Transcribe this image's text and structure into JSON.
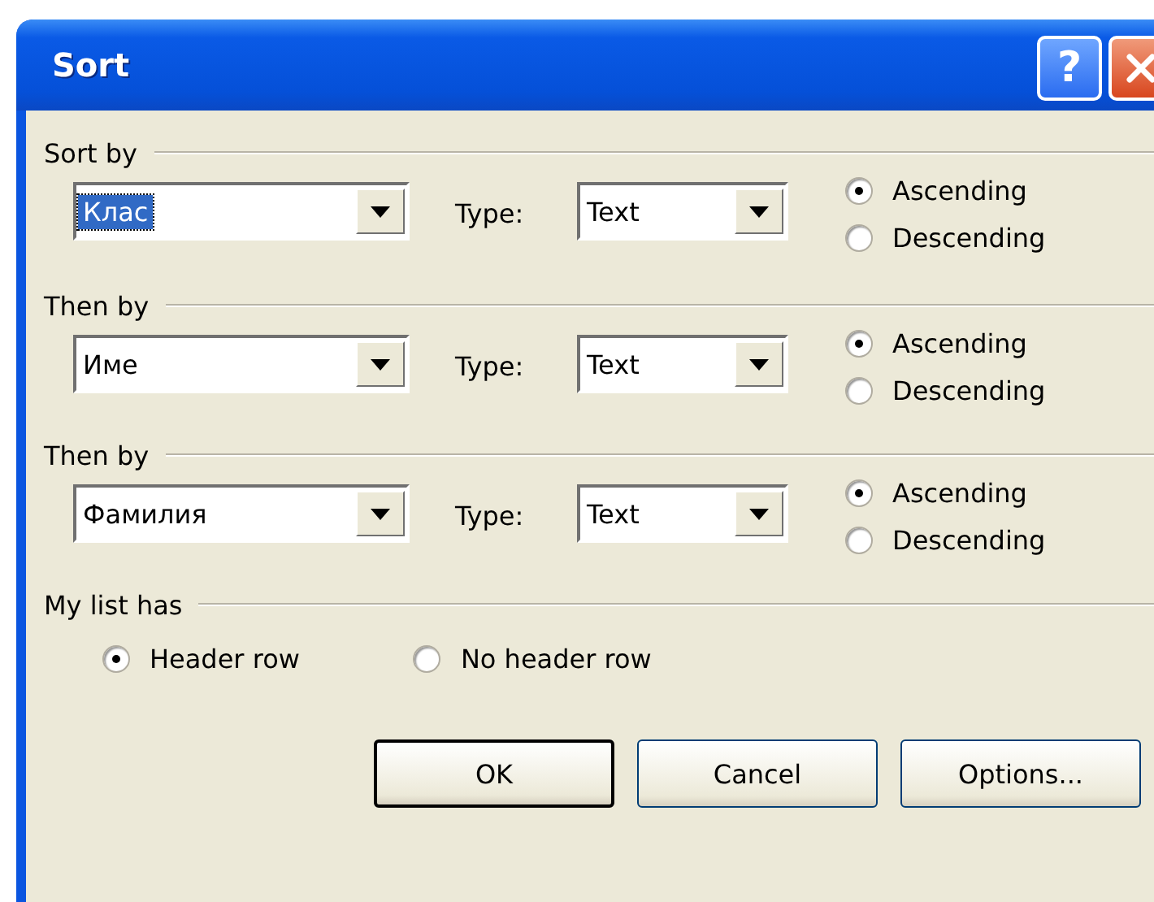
{
  "window": {
    "title": "Sort",
    "help_button": "?"
  },
  "sort_keys": [
    {
      "heading": "Sort by",
      "field": {
        "value": "Клас",
        "highlighted": true
      },
      "type_label": "Type:",
      "type_value": "Text",
      "order": [
        {
          "label": "Ascending",
          "selected": true
        },
        {
          "label": "Descending",
          "selected": false
        }
      ]
    },
    {
      "heading": "Then by",
      "field": {
        "value": "Име",
        "highlighted": false
      },
      "type_label": "Type:",
      "type_value": "Text",
      "order": [
        {
          "label": "Ascending",
          "selected": true
        },
        {
          "label": "Descending",
          "selected": false
        }
      ]
    },
    {
      "heading": "Then by",
      "field": {
        "value": "Фамилия",
        "highlighted": false
      },
      "type_label": "Type:",
      "type_value": "Text",
      "order": [
        {
          "label": "Ascending",
          "selected": true
        },
        {
          "label": "Descending",
          "selected": false
        }
      ]
    }
  ],
  "list_has": {
    "heading": "My list has",
    "options": [
      {
        "label": "Header row",
        "selected": true
      },
      {
        "label": "No header row",
        "selected": false
      }
    ]
  },
  "buttons": [
    {
      "label": "OK",
      "default": true
    },
    {
      "label": "Cancel",
      "default": false
    },
    {
      "label": "Options...",
      "default": false
    }
  ]
}
